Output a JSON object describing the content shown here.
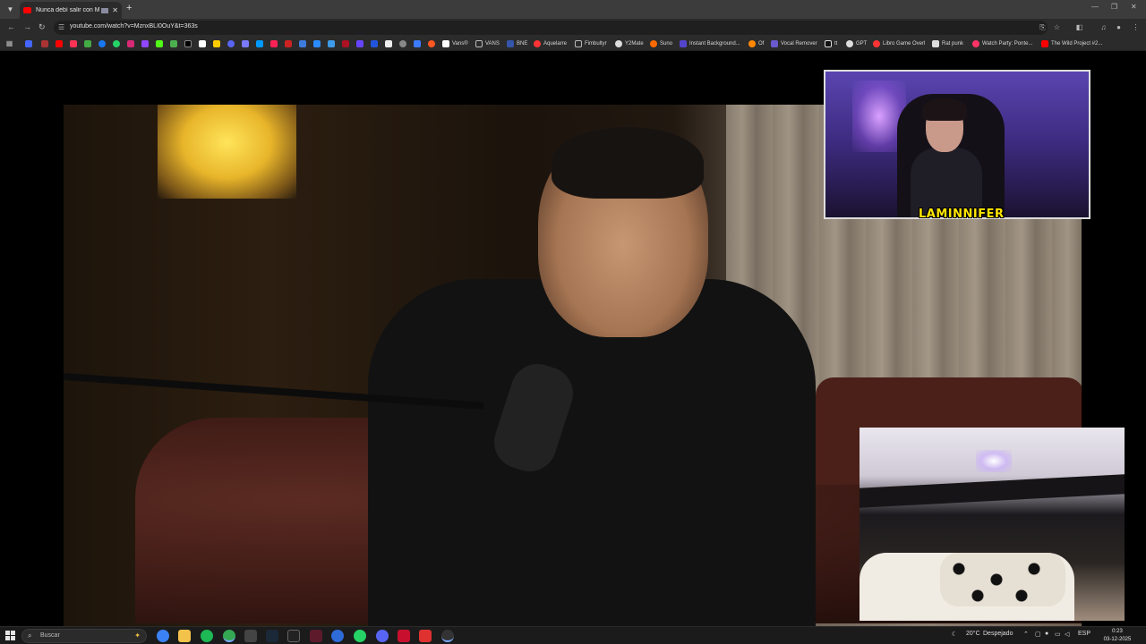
{
  "browser": {
    "tab": {
      "title": "Nunca debí salir con MI M...",
      "close": "✕"
    },
    "new_tab": "+",
    "window_controls": [
      "—",
      "❐",
      "✕"
    ],
    "url": "youtube.com/watch?v=MznxBLI0OuY&t=363s"
  },
  "bookmarks": [
    {
      "label": "Vans®",
      "color": "#ffffff"
    },
    {
      "label": "VANS",
      "color": "#d9a300"
    },
    {
      "label": "BNE",
      "color": "#3355aa"
    },
    {
      "label": "Aquelarre",
      "color": "#ff3333"
    },
    {
      "label": "Fimbultyr",
      "color": "#d9a300"
    },
    {
      "label": "Y2Mate",
      "color": "#dddddd"
    },
    {
      "label": "Suno",
      "color": "#ff6a00"
    },
    {
      "label": "Instant Background...",
      "color": "#5544cc"
    },
    {
      "label": "Of",
      "color": "#ff8800"
    },
    {
      "label": "Vocal Remover",
      "color": "#6a5acd"
    },
    {
      "label": "tt",
      "color": "#ffffff"
    },
    {
      "label": "GPT",
      "color": "#dddddd"
    },
    {
      "label": "Libro Game Overl",
      "color": "#ff3333"
    },
    {
      "label": "Rat punk",
      "color": "#dddddd"
    },
    {
      "label": "Watch Party: Ponte...",
      "color": "#ff3366"
    },
    {
      "label": "The Wild Project #2...",
      "color": "#ff0000"
    }
  ],
  "stream": {
    "channel_tag": "LAMINNIFER"
  },
  "taskbar": {
    "search_placeholder": "Buscar",
    "weather": "20°C",
    "weather_desc": "Despejado",
    "language": "ESP",
    "time": "0:23",
    "date": "03-12-2025"
  },
  "colors": {
    "accent": "#ff0000",
    "channel_tag": "#ffe600"
  }
}
